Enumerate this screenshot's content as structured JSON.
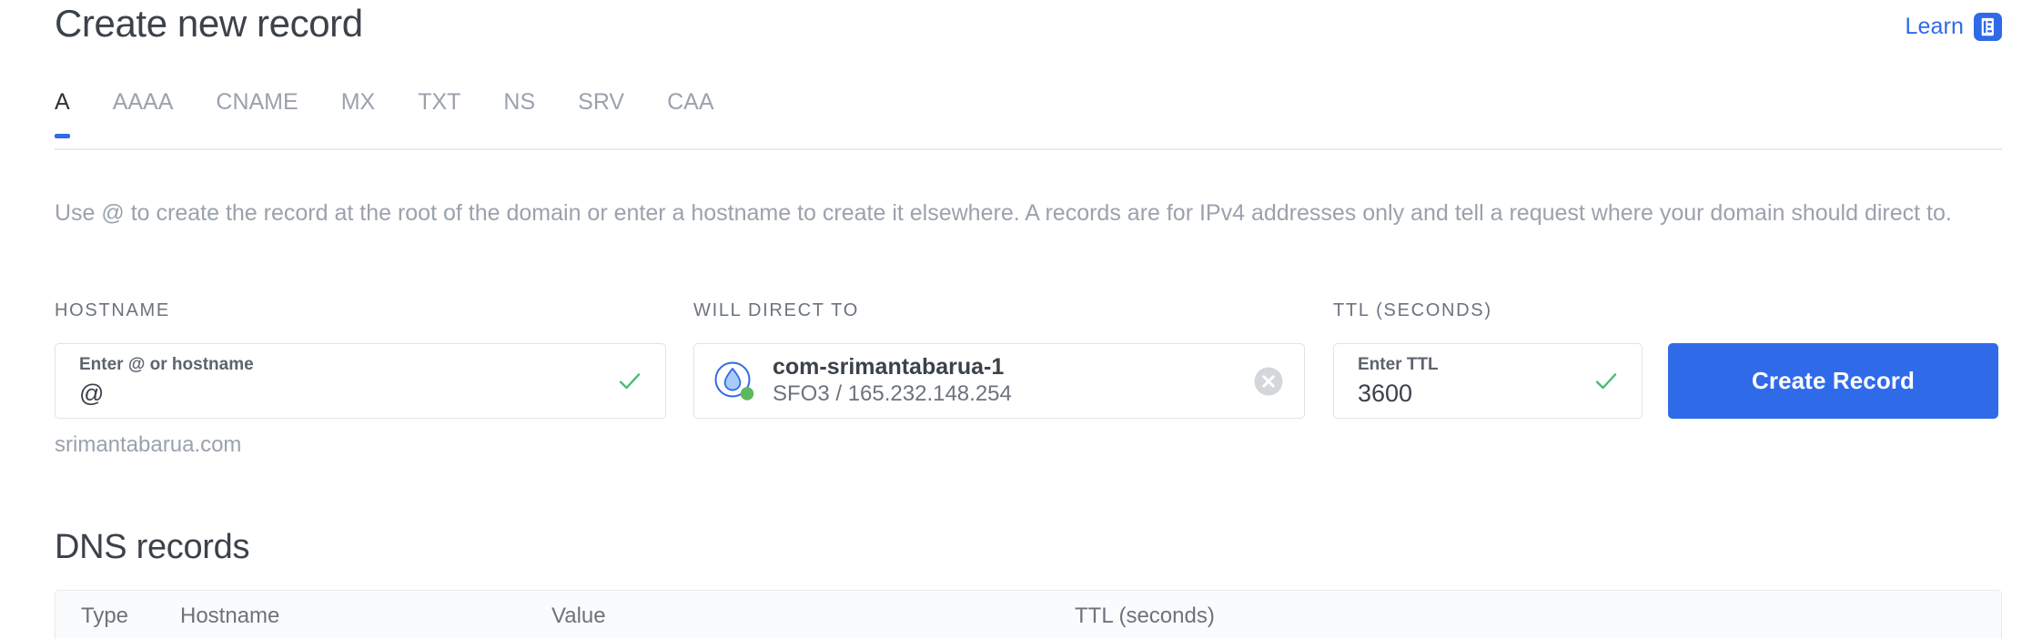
{
  "header": {
    "title": "Create new record",
    "learn_label": "Learn",
    "learn_icon": "article-icon"
  },
  "tabs": {
    "active": "A",
    "items": [
      {
        "label": "A"
      },
      {
        "label": "AAAA"
      },
      {
        "label": "CNAME"
      },
      {
        "label": "MX"
      },
      {
        "label": "TXT"
      },
      {
        "label": "NS"
      },
      {
        "label": "SRV"
      },
      {
        "label": "CAA"
      }
    ]
  },
  "description": "Use @ to create the record at the root of the domain or enter a hostname to create it elsewhere. A records are for IPv4 addresses only and tell a request where your domain should direct to.",
  "form": {
    "hostname": {
      "label": "HOSTNAME",
      "placeholder": "Enter @ or hostname",
      "value": "@",
      "hint": "srimantabarua.com",
      "valid_icon": "check-icon"
    },
    "will_direct_to": {
      "label": "WILL DIRECT TO",
      "droplet_name": "com-srimantabarua-1",
      "droplet_meta": "SFO3 / 165.232.148.254",
      "droplet_icon": "droplet-icon",
      "status_icon": "status-dot-online",
      "clear_icon": "clear-circle-icon"
    },
    "ttl": {
      "label": "TTL (SECONDS)",
      "placeholder": "Enter TTL",
      "value": "3600",
      "valid_icon": "check-icon"
    },
    "submit_label": "Create Record"
  },
  "records": {
    "title": "DNS records",
    "columns": [
      {
        "label": "Type"
      },
      {
        "label": "Hostname"
      },
      {
        "label": "Value"
      },
      {
        "label": "TTL (seconds)"
      }
    ]
  },
  "colors": {
    "accent_blue": "#2f6ae9",
    "valid_green": "#4cbb72",
    "status_green": "#5cb85c",
    "text_dark": "#3c4249",
    "text_muted": "#9aa2ac",
    "border": "#dfe3e8"
  }
}
